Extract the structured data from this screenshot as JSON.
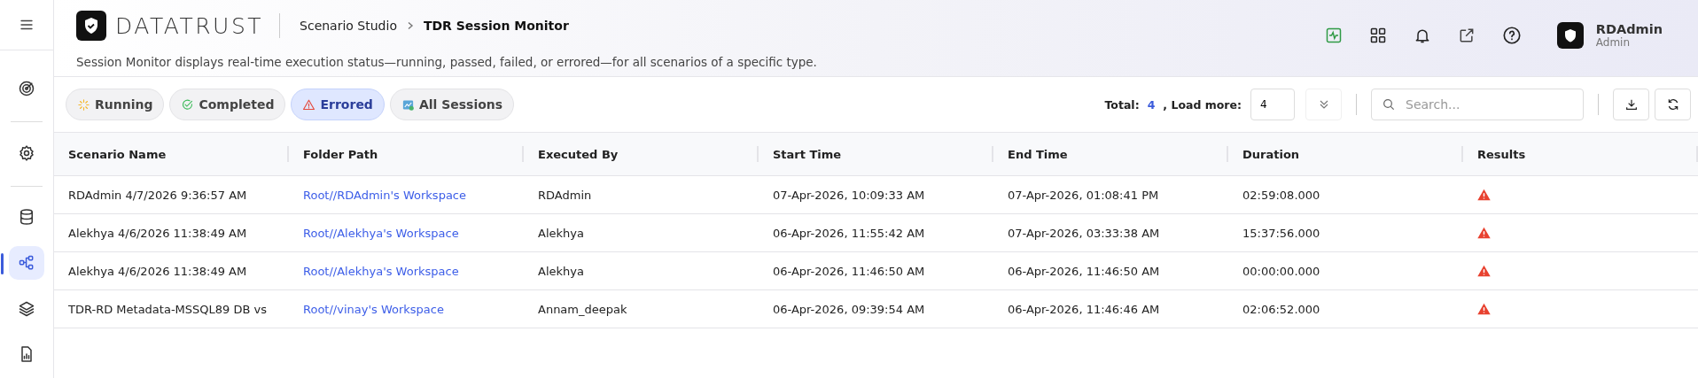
{
  "sidebar": {
    "items": [
      {
        "kind": "target",
        "selected": false
      },
      {
        "kind": "gear",
        "selected": false
      },
      {
        "kind": "database",
        "selected": false
      },
      {
        "kind": "flow",
        "selected": true
      },
      {
        "kind": "layers",
        "selected": false
      },
      {
        "kind": "report",
        "selected": false
      }
    ]
  },
  "header": {
    "logo": "DATATRUST",
    "breadcrumb": [
      "Scenario Studio",
      "TDR Session Monitor"
    ],
    "description": "Session Monitor displays real-time execution status—running, passed, failed, or errored—for all scenarios of a specific type.",
    "user": {
      "name": "RDAdmin",
      "role": "Admin"
    }
  },
  "filters": [
    {
      "label": "Running",
      "kind": "running",
      "selected": false
    },
    {
      "label": "Completed",
      "kind": "completed",
      "selected": false
    },
    {
      "label": "Errored",
      "kind": "errored",
      "selected": true
    },
    {
      "label": "All Sessions",
      "kind": "all",
      "selected": false
    }
  ],
  "toolbar": {
    "total_label": "Total:",
    "total": "4",
    "load_more_label": ", Load more:",
    "load_more": "4",
    "search_placeholder": "Search..."
  },
  "table": {
    "columns": [
      "Scenario Name",
      "Folder Path",
      "Executed By",
      "Start Time",
      "End Time",
      "Duration",
      "Results"
    ],
    "rows": [
      {
        "scenario": "RDAdmin 4/7/2026 9:36:57 AM",
        "folder": "Root//RDAdmin's Workspace",
        "executed_by": "RDAdmin",
        "start": "07-Apr-2026, 10:09:33 AM",
        "end": "07-Apr-2026, 01:08:41 PM",
        "duration": "02:59:08.000",
        "kind": "errored"
      },
      {
        "scenario": "Alekhya 4/6/2026 11:38:49 AM",
        "folder": "Root//Alekhya's Workspace",
        "executed_by": "Alekhya",
        "start": "06-Apr-2026, 11:55:42 AM",
        "end": "07-Apr-2026, 03:33:38 AM",
        "duration": "15:37:56.000",
        "kind": "errored"
      },
      {
        "scenario": "Alekhya 4/6/2026 11:38:49 AM",
        "folder": "Root//Alekhya's Workspace",
        "executed_by": "Alekhya",
        "start": "06-Apr-2026, 11:46:50 AM",
        "end": "06-Apr-2026, 11:46:50 AM",
        "duration": "00:00:00.000",
        "kind": "errored"
      },
      {
        "scenario": "TDR-RD Metadata-MSSQL89 DB vs",
        "folder": "Root//vinay's Workspace",
        "executed_by": "Annam_deepak",
        "start": "06-Apr-2026, 09:39:54 AM",
        "end": "06-Apr-2026, 11:46:46 AM",
        "duration": "02:06:52.000",
        "kind": "errored"
      }
    ]
  }
}
